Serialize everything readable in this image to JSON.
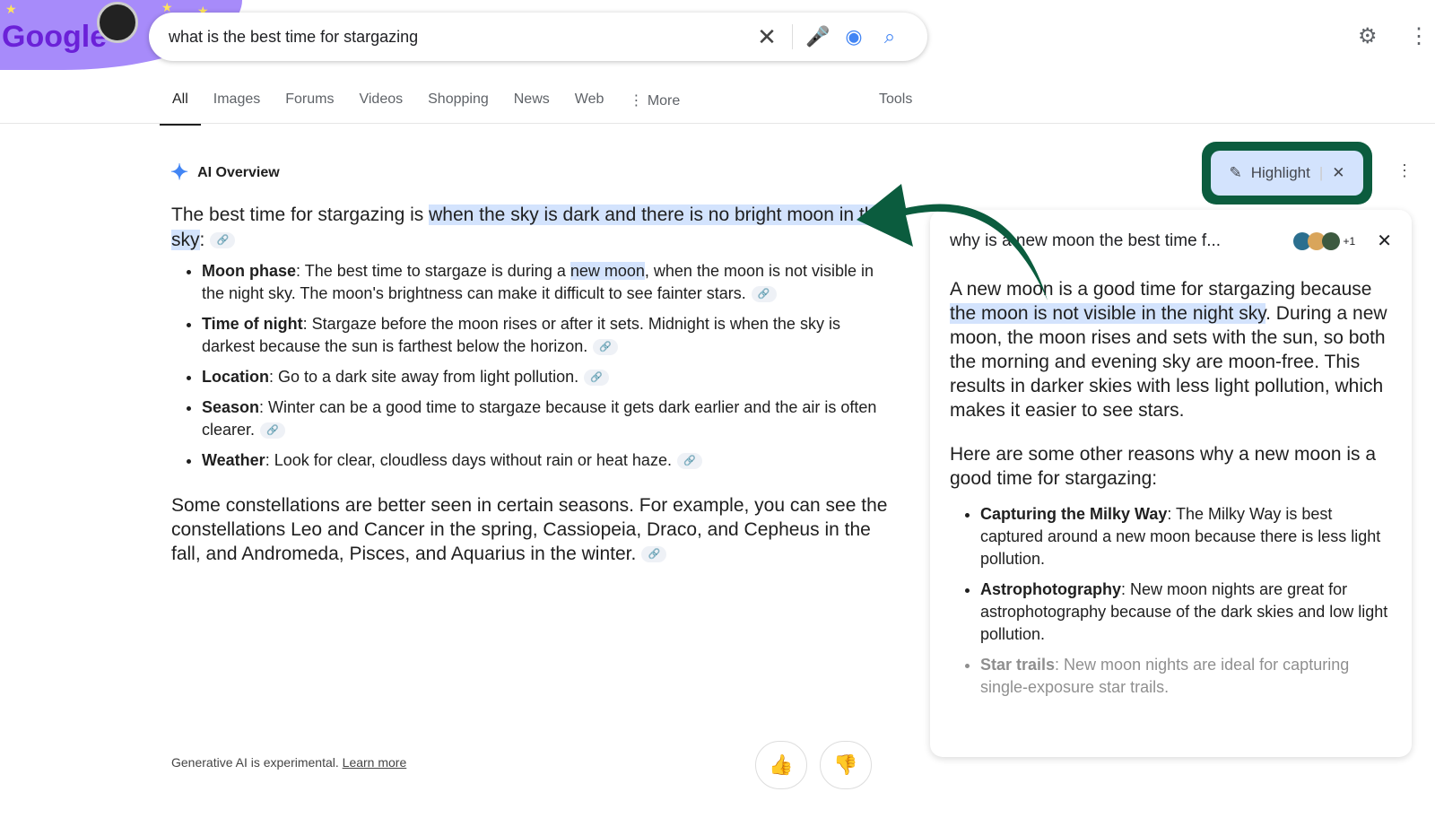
{
  "logo": "Google",
  "search": {
    "query": "what is the best time for stargazing"
  },
  "tabs": [
    {
      "label": "All"
    },
    {
      "label": "Images"
    },
    {
      "label": "Forums"
    },
    {
      "label": "Videos"
    },
    {
      "label": "Shopping"
    },
    {
      "label": "News"
    },
    {
      "label": "Web"
    },
    {
      "label": "⋮ More"
    }
  ],
  "tools": "Tools",
  "ai_overview": {
    "title": "AI Overview",
    "lead_pre": "The best time for stargazing is ",
    "lead_hl": "when the sky is dark and there is no bright moon in the sky",
    "lead_post": ":",
    "bullets": [
      {
        "term": "Moon phase",
        "pre": ": The best time to stargaze is during a ",
        "hl": "new moon",
        "post": ", when the moon is not visible in the night sky. The moon's brightness can make it difficult to see fainter stars."
      },
      {
        "term": "Time of night",
        "pre": ": Stargaze before the moon rises or after it sets. Midnight is when the sky is darkest because the sun is farthest below the horizon.",
        "hl": "",
        "post": ""
      },
      {
        "term": "Location",
        "pre": ": Go to a dark site away from light pollution.",
        "hl": "",
        "post": ""
      },
      {
        "term": "Season",
        "pre": ": Winter can be a good time to stargaze because it gets dark earlier and the air is often clearer.",
        "hl": "",
        "post": ""
      },
      {
        "term": "Weather",
        "pre": ": Look for clear, cloudless days without rain or heat haze.",
        "hl": "",
        "post": ""
      }
    ],
    "para": "Some constellations are better seen in certain seasons. For example, you can see the constellations Leo and Cancer in the spring, Cassiopeia, Draco, and Cepheus in the fall, and Andromeda, Pisces, and Aquarius in the winter."
  },
  "footer": {
    "text": "Generative AI is experimental. ",
    "link": "Learn more"
  },
  "highlight": {
    "label": "Highlight"
  },
  "panel": {
    "title": "why is a new moon the best time f...",
    "more": "+1",
    "p1_pre": "A new moon is a good time for stargazing because ",
    "p1_hl": "the moon is not visible in the night sky",
    "p1_post": ". During a new moon, the moon rises and sets with the sun, so both the morning and evening sky are moon-free. This results in darker skies with less light pollution, which makes it easier to see stars.",
    "p2": "Here are some other reasons why a new moon is a good time for stargazing:",
    "bullets": [
      {
        "term": "Capturing the Milky Way",
        "text": ": The Milky Way is best captured around a new moon because there is less light pollution."
      },
      {
        "term": "Astrophotography",
        "text": ": New moon nights are great for astrophotography because of the dark skies and low light pollution."
      },
      {
        "term": "Star trails",
        "text": ": New moon nights are ideal for capturing single-exposure star trails."
      }
    ]
  },
  "colors": {
    "highlight": "#d3e3fd",
    "annotation": "#0b5c3e",
    "accent": "#4285f4"
  }
}
